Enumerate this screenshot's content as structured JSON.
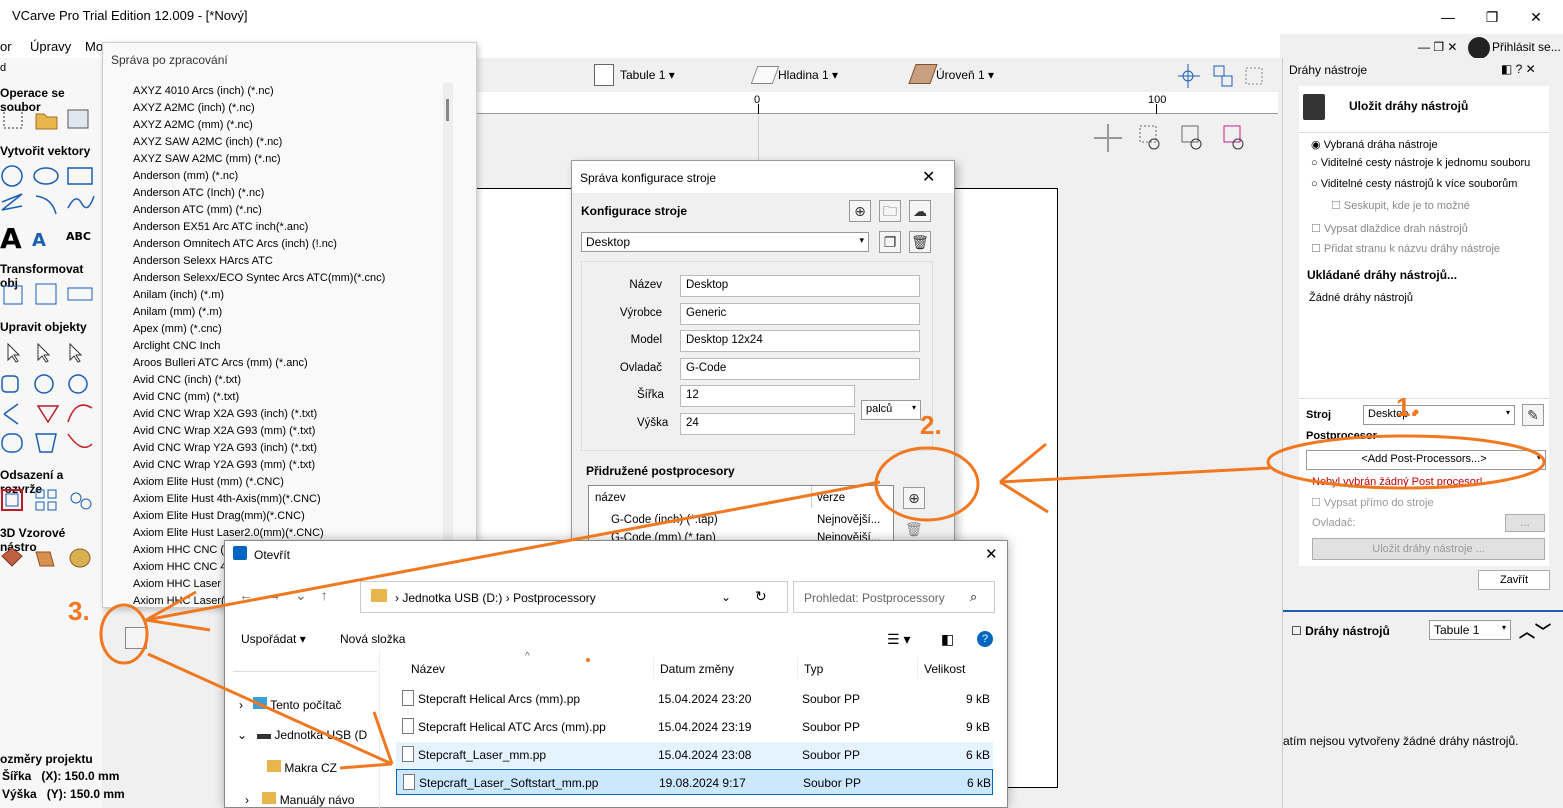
{
  "window": {
    "title": "VCarve Pro Trial Edition 12.009 - [*Nový]",
    "login": "Přihlásit se..."
  },
  "menu": [
    "or",
    "Úpravy",
    "Mo"
  ],
  "left_panel": {
    "sections": [
      "Operace se soubor",
      "Vytvořit vektory",
      "Transformovat obj",
      "Upravit objekty",
      "Odsazení a rozvrže",
      "3D Vzorové nástro"
    ],
    "size": {
      "title": "ozměry projektu",
      "width": "Šířka   (X): 150.0 mm",
      "height": "Výška   (Y): 150.0 mm"
    }
  },
  "post_list": {
    "title": "Správa po zpracování",
    "items": [
      "AXYZ 4010 Arcs (inch) (*.nc)",
      "AXYZ A2MC (inch) (*.nc)",
      "AXYZ A2MC (mm) (*.nc)",
      "AXYZ SAW A2MC (inch) (*.nc)",
      "AXYZ SAW A2MC (mm) (*.nc)",
      "Anderson (mm) (*.nc)",
      "Anderson ATC (Inch) (*.nc)",
      "Anderson ATC (mm) (*.nc)",
      "Anderson EX51 Arc ATC inch(*.anc)",
      "Anderson Omnitech ATC Arcs (inch) (!.nc)",
      "Anderson Selexx HArcs ATC",
      "Anderson Selexx/ECO Syntec Arcs ATC(mm)(*.cnc)",
      "Anilam (inch) (*.m)",
      "Anilam (mm) (*.m)",
      "Apex (mm) (*.cnc)",
      "Arclight CNC Inch",
      "Aroos Bulleri ATC Arcs (mm) (*.anc)",
      "Avid CNC (inch) (*.txt)",
      "Avid CNC (mm) (*.txt)",
      "Avid CNC Wrap X2A G93 (inch) (*.txt)",
      "Avid CNC Wrap X2A G93 (mm) (*.txt)",
      "Avid CNC Wrap Y2A G93 (inch) (*.txt)",
      "Avid CNC Wrap Y2A G93 (mm)  (*.txt)",
      "Axiom Elite Hust (mm) (*.CNC)",
      "Axiom Elite Hust 4th-Axis(mm)(*.CNC)",
      "Axiom Elite Hust Drag(mm)(*.CNC)",
      "Axiom Elite Hust Laser2.0(mm)(*.CNC)",
      "Axiom HHC CNC (m",
      "Axiom HHC CNC 4T",
      "Axiom HHC Laser B",
      "Axiom HHC Laser(\\"
    ]
  },
  "toolbar": {
    "sheet": "Tabule 1",
    "layer": "Hladina 1",
    "level": "Úroveň 1",
    "ruler": [
      "0",
      "100"
    ]
  },
  "machine_dialog": {
    "title": "Správa konfigurace stroje",
    "config_label": "Konfigurace stroje",
    "config_value": "Desktop",
    "fields": [
      {
        "label": "Název",
        "value": "Desktop"
      },
      {
        "label": "Výrobce",
        "value": "Generic"
      },
      {
        "label": "Model",
        "value": "Desktop 12x24"
      },
      {
        "label": "Ovladač",
        "value": "G-Code"
      }
    ],
    "width_label": "Šířka",
    "width_value": "12",
    "height_label": "Výška",
    "height_value": "24",
    "unit": "palců",
    "pp_label": "Přidružené postprocesory",
    "col_name": "název",
    "col_ver": "verze",
    "pp_rows": [
      {
        "name": "G-Code (inch) (*.tap)",
        "ver": "Nejnovější..."
      },
      {
        "name": "G-Code (mm) (*.tap)",
        "ver": "Nejnovější..."
      }
    ]
  },
  "right_panel": {
    "header": "Dráhy nástroje",
    "save_title": "Uložit dráhy nástrojů",
    "radios": [
      "Vybraná dráha nástroje",
      "Viditelné cesty nástroje k jednomu souboru",
      "Viditelné cesty nástrojů k více souborům"
    ],
    "checks": [
      "Seskupit, kde je to možné",
      "Vypsat dlaždice drah nástrojů",
      "Přidat stranu k názvu dráhy nástroje"
    ],
    "saving_label": "Ukládané dráhy nástrojů...",
    "no_paths": "Žádné dráhy nástrojů",
    "machine_label": "Stroj",
    "machine_value": "Desktop",
    "post_label": "Postprocesor",
    "post_value": "<Add Post-Processors...>",
    "error": "Nebyl vybrán žádný Post procesor!",
    "direct_check": "Vypsat přímo do stroje",
    "driver_label": "Ovladač:",
    "driver_btn": "...",
    "save_btn": "Uložit dráhy nástroje ...",
    "close_btn": "Zavřít",
    "list_title": "Dráhy nástrojů",
    "list_sheet": "Tabule 1",
    "empty_msg": "atím nejsou vytvořeny žádné dráhy nástrojů."
  },
  "open_dialog": {
    "title": "Otevřít",
    "path": [
      "Jednotka USB (D:)",
      "Postprocessory"
    ],
    "search_placeholder": "Prohledat: Postprocessory",
    "organize": "Uspořádat",
    "new_folder": "Nová složka",
    "cols": [
      "Název",
      "Datum změny",
      "Typ",
      "Velikost"
    ],
    "tree": [
      "Tento počítač",
      "Jednotka USB (D",
      "Makra CZ",
      "Manuály návo"
    ],
    "files": [
      {
        "name": "Stepcraft Helical Arcs (mm).pp",
        "date": "15.04.2024 23:20",
        "type": "Soubor PP",
        "size": "9 kB"
      },
      {
        "name": "Stepcraft Helical ATC Arcs (mm).pp",
        "date": "15.04.2024 23:19",
        "type": "Soubor PP",
        "size": "9 kB"
      },
      {
        "name": "Stepcraft_Laser_mm.pp",
        "date": "15.04.2024 23:08",
        "type": "Soubor PP",
        "size": "6 kB"
      },
      {
        "name": "Stepcraft_Laser_Softstart_mm.pp",
        "date": "19.08.2024 9:17",
        "type": "Soubor PP",
        "size": "6 kB"
      }
    ]
  },
  "annotations": {
    "n1": "1.",
    "n2": "2.",
    "n3": "3."
  },
  "colors": {
    "accent": "#f07820",
    "selection": "#cce8ff",
    "link": "#0067c0",
    "error": "#c00000"
  }
}
